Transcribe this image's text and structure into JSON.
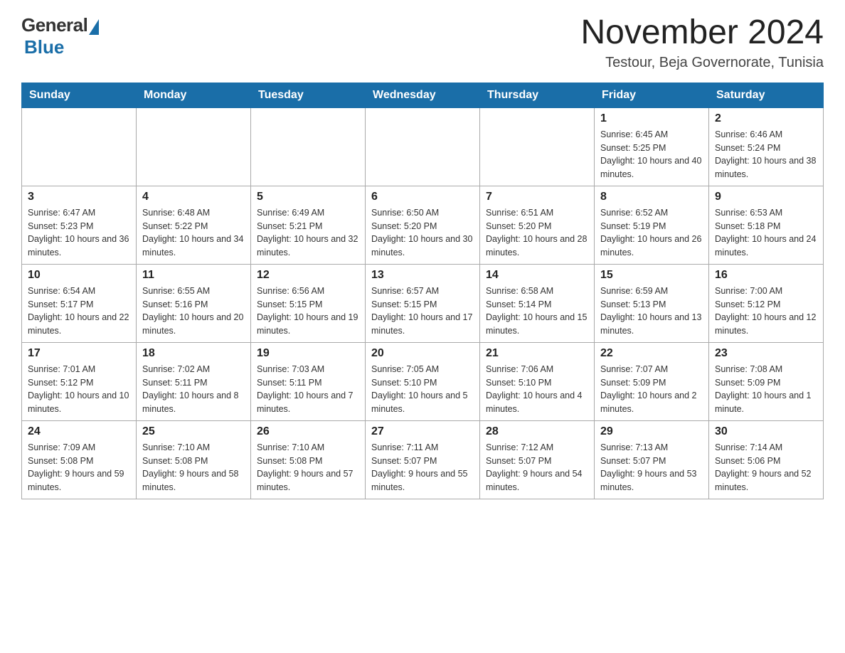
{
  "header": {
    "logo": {
      "general": "General",
      "blue": "Blue"
    },
    "title": "November 2024",
    "location": "Testour, Beja Governorate, Tunisia"
  },
  "calendar": {
    "days_of_week": [
      "Sunday",
      "Monday",
      "Tuesday",
      "Wednesday",
      "Thursday",
      "Friday",
      "Saturday"
    ],
    "weeks": [
      [
        {
          "day": "",
          "info": ""
        },
        {
          "day": "",
          "info": ""
        },
        {
          "day": "",
          "info": ""
        },
        {
          "day": "",
          "info": ""
        },
        {
          "day": "",
          "info": ""
        },
        {
          "day": "1",
          "info": "Sunrise: 6:45 AM\nSunset: 5:25 PM\nDaylight: 10 hours and 40 minutes."
        },
        {
          "day": "2",
          "info": "Sunrise: 6:46 AM\nSunset: 5:24 PM\nDaylight: 10 hours and 38 minutes."
        }
      ],
      [
        {
          "day": "3",
          "info": "Sunrise: 6:47 AM\nSunset: 5:23 PM\nDaylight: 10 hours and 36 minutes."
        },
        {
          "day": "4",
          "info": "Sunrise: 6:48 AM\nSunset: 5:22 PM\nDaylight: 10 hours and 34 minutes."
        },
        {
          "day": "5",
          "info": "Sunrise: 6:49 AM\nSunset: 5:21 PM\nDaylight: 10 hours and 32 minutes."
        },
        {
          "day": "6",
          "info": "Sunrise: 6:50 AM\nSunset: 5:20 PM\nDaylight: 10 hours and 30 minutes."
        },
        {
          "day": "7",
          "info": "Sunrise: 6:51 AM\nSunset: 5:20 PM\nDaylight: 10 hours and 28 minutes."
        },
        {
          "day": "8",
          "info": "Sunrise: 6:52 AM\nSunset: 5:19 PM\nDaylight: 10 hours and 26 minutes."
        },
        {
          "day": "9",
          "info": "Sunrise: 6:53 AM\nSunset: 5:18 PM\nDaylight: 10 hours and 24 minutes."
        }
      ],
      [
        {
          "day": "10",
          "info": "Sunrise: 6:54 AM\nSunset: 5:17 PM\nDaylight: 10 hours and 22 minutes."
        },
        {
          "day": "11",
          "info": "Sunrise: 6:55 AM\nSunset: 5:16 PM\nDaylight: 10 hours and 20 minutes."
        },
        {
          "day": "12",
          "info": "Sunrise: 6:56 AM\nSunset: 5:15 PM\nDaylight: 10 hours and 19 minutes."
        },
        {
          "day": "13",
          "info": "Sunrise: 6:57 AM\nSunset: 5:15 PM\nDaylight: 10 hours and 17 minutes."
        },
        {
          "day": "14",
          "info": "Sunrise: 6:58 AM\nSunset: 5:14 PM\nDaylight: 10 hours and 15 minutes."
        },
        {
          "day": "15",
          "info": "Sunrise: 6:59 AM\nSunset: 5:13 PM\nDaylight: 10 hours and 13 minutes."
        },
        {
          "day": "16",
          "info": "Sunrise: 7:00 AM\nSunset: 5:12 PM\nDaylight: 10 hours and 12 minutes."
        }
      ],
      [
        {
          "day": "17",
          "info": "Sunrise: 7:01 AM\nSunset: 5:12 PM\nDaylight: 10 hours and 10 minutes."
        },
        {
          "day": "18",
          "info": "Sunrise: 7:02 AM\nSunset: 5:11 PM\nDaylight: 10 hours and 8 minutes."
        },
        {
          "day": "19",
          "info": "Sunrise: 7:03 AM\nSunset: 5:11 PM\nDaylight: 10 hours and 7 minutes."
        },
        {
          "day": "20",
          "info": "Sunrise: 7:05 AM\nSunset: 5:10 PM\nDaylight: 10 hours and 5 minutes."
        },
        {
          "day": "21",
          "info": "Sunrise: 7:06 AM\nSunset: 5:10 PM\nDaylight: 10 hours and 4 minutes."
        },
        {
          "day": "22",
          "info": "Sunrise: 7:07 AM\nSunset: 5:09 PM\nDaylight: 10 hours and 2 minutes."
        },
        {
          "day": "23",
          "info": "Sunrise: 7:08 AM\nSunset: 5:09 PM\nDaylight: 10 hours and 1 minute."
        }
      ],
      [
        {
          "day": "24",
          "info": "Sunrise: 7:09 AM\nSunset: 5:08 PM\nDaylight: 9 hours and 59 minutes."
        },
        {
          "day": "25",
          "info": "Sunrise: 7:10 AM\nSunset: 5:08 PM\nDaylight: 9 hours and 58 minutes."
        },
        {
          "day": "26",
          "info": "Sunrise: 7:10 AM\nSunset: 5:08 PM\nDaylight: 9 hours and 57 minutes."
        },
        {
          "day": "27",
          "info": "Sunrise: 7:11 AM\nSunset: 5:07 PM\nDaylight: 9 hours and 55 minutes."
        },
        {
          "day": "28",
          "info": "Sunrise: 7:12 AM\nSunset: 5:07 PM\nDaylight: 9 hours and 54 minutes."
        },
        {
          "day": "29",
          "info": "Sunrise: 7:13 AM\nSunset: 5:07 PM\nDaylight: 9 hours and 53 minutes."
        },
        {
          "day": "30",
          "info": "Sunrise: 7:14 AM\nSunset: 5:06 PM\nDaylight: 9 hours and 52 minutes."
        }
      ]
    ]
  }
}
